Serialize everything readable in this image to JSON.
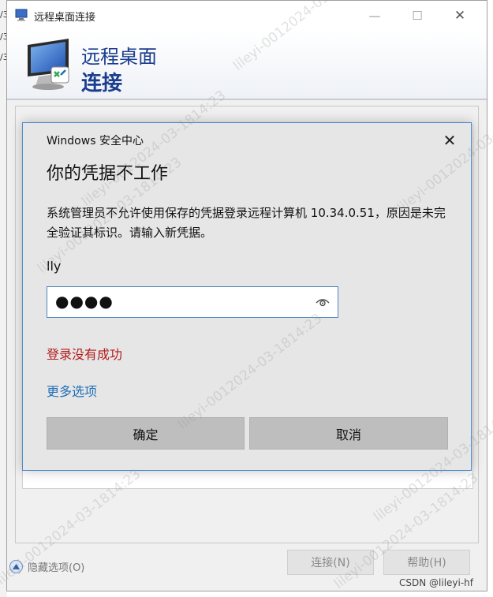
{
  "background_edge": {
    "fragments": [
      "/3",
      "/3",
      "/3"
    ]
  },
  "rdp_window": {
    "title": "远程桌面连接",
    "banner_line1": "远程桌面",
    "banner_line2": "连接",
    "connect_button": "连接(N)",
    "help_button": "帮助(H)",
    "hide_options": "隐藏选项(O)"
  },
  "dialog": {
    "title": "Windows 安全中心",
    "heading": "你的凭据不工作",
    "message": "系统管理员不允许使用保存的凭据登录远程计算机 10.34.0.51，原因是未完全验证其标识。请输入新凭据。",
    "username": "lly",
    "password_mask": "●●●●",
    "error": "登录没有成功",
    "more_options": "更多选项",
    "ok_button": "确定",
    "cancel_button": "取消"
  },
  "watermarks": [
    "lileyi-0012024-03-1814:23",
    "lileyi-0012024-03-1814:23",
    "lileyi-0012024-03-1814:23",
    "lileyi-0012024-03-1814:23",
    "lileyi-0012024-03-1814:23",
    "lileyi-0012024-03-1814:23",
    "lileyi-0012024-03-1814:23",
    "lileyi-0012024-03-1814:23"
  ],
  "footer_credit": "CSDN @lileyi-hf",
  "colors": {
    "banner_text": "#1b3d8f",
    "error_text": "#b31b1b",
    "link_text": "#1f6fb8",
    "dialog_border": "#4a8ac9"
  }
}
